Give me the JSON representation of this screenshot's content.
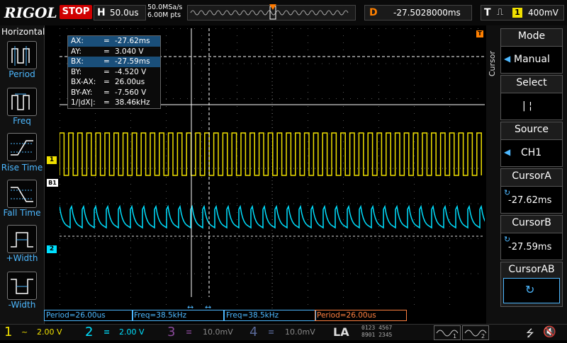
{
  "topbar": {
    "logo": "RIGOL",
    "run_state": "STOP",
    "timebase_letter": "H",
    "timebase": "50.0us",
    "sample_rate": "50.0MSa/s",
    "memory_depth": "6.00M pts",
    "delay_letter": "D",
    "delay": "-27.5028000ms",
    "trigger_letter": "T",
    "trigger_edge": "⎍",
    "trigger_channel": "1",
    "trigger_level": "400mV",
    "colors": {
      "stop": "#d00000",
      "trigger": "#ff8000",
      "ch1": "#f0e000",
      "ch2": "#00e0ff"
    }
  },
  "left_menu": {
    "header": "Horizontal",
    "items": [
      {
        "label": "Period",
        "icon": "period-icon"
      },
      {
        "label": "Freq",
        "icon": "freq-icon"
      },
      {
        "label": "Rise Time",
        "icon": "rise-time-icon"
      },
      {
        "label": "Fall Time",
        "icon": "fall-time-icon"
      },
      {
        "label": "+Width",
        "icon": "positive-width-icon"
      },
      {
        "label": "-Width",
        "icon": "negative-width-icon"
      }
    ]
  },
  "cursor_readout": [
    {
      "key": "AX:",
      "eq": "=",
      "value": "-27.62ms"
    },
    {
      "key": "AY:",
      "eq": "=",
      "value": "3.040 V"
    },
    {
      "key": "BX:",
      "eq": "=",
      "value": "-27.59ms"
    },
    {
      "key": "BY:",
      "eq": "=",
      "value": "-4.520 V"
    },
    {
      "key": "BX-AX:",
      "eq": "=",
      "value": "26.00us"
    },
    {
      "key": "BY-AY:",
      "eq": "=",
      "value": "-7.560 V"
    },
    {
      "key": "1/|dX|:",
      "eq": "=",
      "value": "38.46kHz"
    }
  ],
  "markers": {
    "ch1": "1",
    "ch2": "2",
    "trigger": "T",
    "b1": "B1"
  },
  "right_menu": {
    "side_label": "Cursor",
    "mode_title": "Mode",
    "mode_value": "Manual",
    "select_title": "Select",
    "select_value": "|    ¦",
    "source_title": "Source",
    "source_value": "CH1",
    "cursor_a_title": "CursorA",
    "cursor_a_value": "-27.62ms",
    "cursor_b_title": "CursorB",
    "cursor_b_value": "-27.59ms",
    "cursor_ab_title": "CursorAB",
    "cursor_ab_icon": "↻"
  },
  "measurements": [
    {
      "label": "Period=26.00us",
      "color": "#4db8ff"
    },
    {
      "label": "Freq=38.5kHz",
      "color": "#4db8ff"
    },
    {
      "label": "Freq=38.5kHz",
      "color": "#4db8ff"
    },
    {
      "label": "Period=26.00us",
      "color": "#ff8040"
    }
  ],
  "channels": [
    {
      "num": "1",
      "coupling": "~",
      "scale": "2.00 V",
      "color": "#f0e000"
    },
    {
      "num": "2",
      "coupling": "≡",
      "scale": "2.00 V",
      "color": "#00e0ff"
    },
    {
      "num": "3",
      "coupling": "≡",
      "scale": "10.0mV",
      "color": "#8a4a9a"
    },
    {
      "num": "4",
      "coupling": "≡",
      "scale": "10.0mV",
      "color": "#5a6a9a"
    }
  ],
  "la_label": "LA",
  "la_bits": [
    "0123 4567",
    "8901 2345"
  ]
}
